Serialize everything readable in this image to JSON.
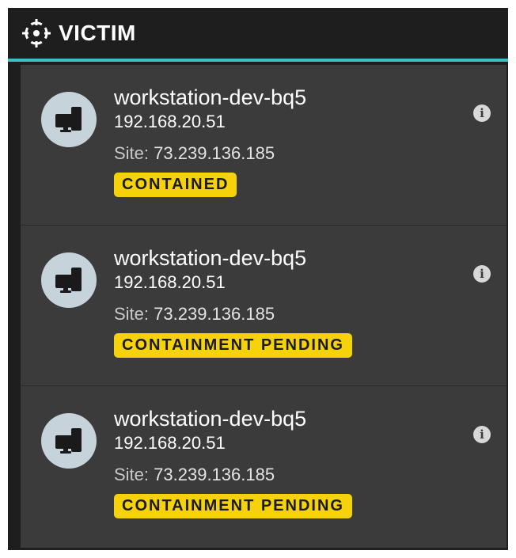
{
  "header": {
    "title": "VICTIM",
    "icon": "crosshair-icon",
    "accent": "#3cc1c4"
  },
  "colors": {
    "panel_bg": "#1e1e1e",
    "card_bg": "#3b3b3b",
    "badge_bg": "#f5d20a",
    "avatar_bg": "#c7d3da"
  },
  "hosts": [
    {
      "hostname": "workstation-dev-bq5",
      "ip": "192.168.20.51",
      "site_label": "Site:",
      "site_value": "73.239.136.185",
      "status": "CONTAINED"
    },
    {
      "hostname": "workstation-dev-bq5",
      "ip": "192.168.20.51",
      "site_label": "Site:",
      "site_value": "73.239.136.185",
      "status": "CONTAINMENT PENDING"
    },
    {
      "hostname": "workstation-dev-bq5",
      "ip": "192.168.20.51",
      "site_label": "Site:",
      "site_value": "73.239.136.185",
      "status": "CONTAINMENT PENDING"
    }
  ],
  "info_glyph": "i"
}
